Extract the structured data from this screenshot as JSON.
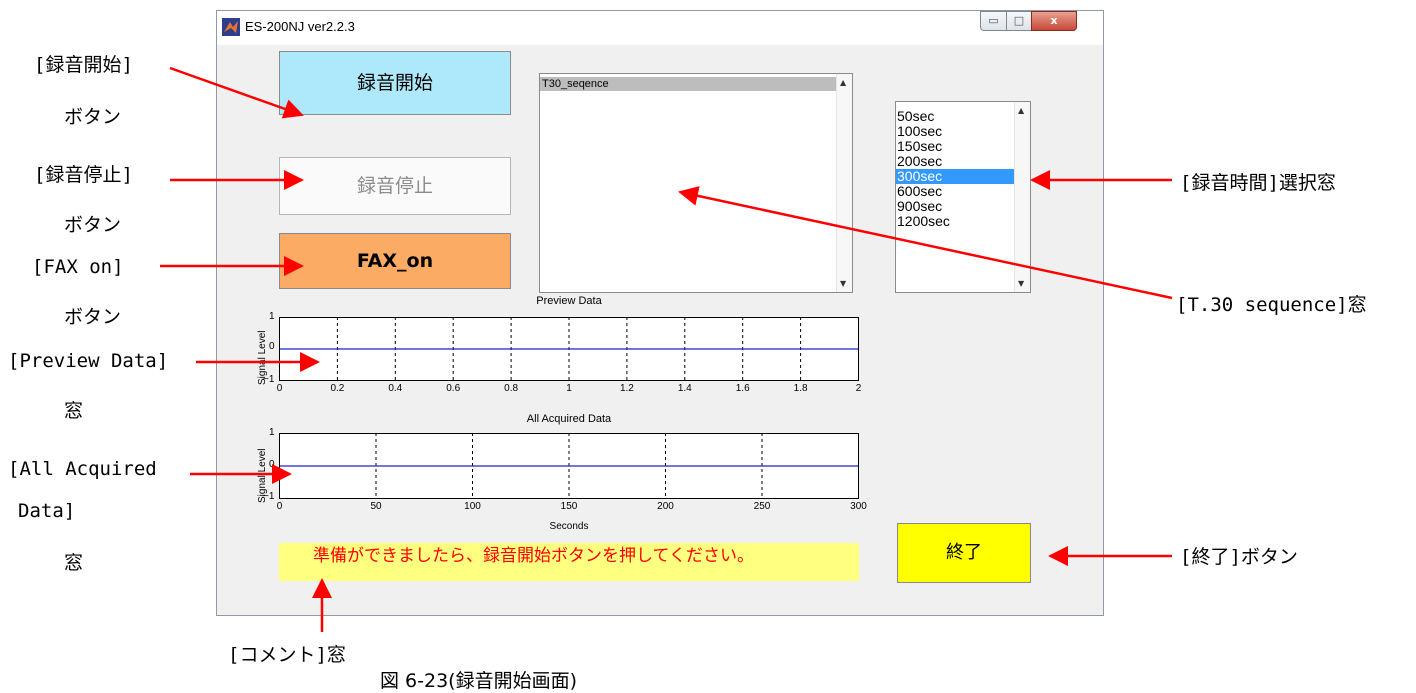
{
  "window": {
    "title": "ES-200NJ  ver2.2.3",
    "controls": {
      "minimize": "▭",
      "maximize": "□",
      "close": "x"
    }
  },
  "buttons": {
    "start": "録音開始",
    "stop": "録音停止",
    "fax_on": "FAX_on",
    "end": "終了"
  },
  "sequence_list": {
    "items": [
      "T30_seqence"
    ]
  },
  "time_list": {
    "items": [
      "50sec",
      "100sec",
      "150sec",
      "200sec",
      "300sec",
      "600sec",
      "900sec",
      "1200sec"
    ],
    "selected": "300sec"
  },
  "comment": "準備ができましたら、録音開始ボタンを押してください。",
  "plots": {
    "preview": {
      "title": "Preview Data",
      "ylabel": "Signal Level",
      "xticks": [
        "0",
        "0.2",
        "0.4",
        "0.6",
        "0.8",
        "1",
        "1.2",
        "1.4",
        "1.6",
        "1.8",
        "2"
      ],
      "yticks": [
        "1",
        "0",
        "−1"
      ],
      "xlim": [
        0,
        2
      ],
      "ylim": [
        -1,
        1
      ],
      "signal_value": 0
    },
    "all": {
      "title": "All Acquired Data",
      "ylabel": "Signal Level",
      "xlabel": "Seconds",
      "xticks": [
        "0",
        "50",
        "100",
        "150",
        "200",
        "250",
        "300"
      ],
      "yticks": [
        "1",
        "0",
        "−1"
      ],
      "xlim": [
        0,
        300
      ],
      "ylim": [
        -1,
        1
      ],
      "signal_value": 0
    }
  },
  "annotations": {
    "start_btn_1": "[録音開始]",
    "start_btn_2": "ボタン",
    "stop_btn_1": "[録音停止]",
    "stop_btn_2": "ボタン",
    "fax_btn_1": "[FAX on]",
    "fax_btn_2": "ボタン",
    "preview_1": "[Preview Data]",
    "preview_2": "窓",
    "all_1": "[All Acquired",
    "all_2": "Data]",
    "all_3": "窓",
    "time_select": "[録音時間]選択窓",
    "t30": "[T.30 sequence]窓",
    "end_btn": "[終了]ボタン",
    "comment": "[コメント]窓",
    "caption": "図 6-23(録音開始画面)"
  },
  "colors": {
    "annotation_arrow": "#ff0000",
    "start_button": "#aee9fb",
    "fax_button": "#fbab63",
    "end_button": "#ffff00",
    "comment_bg": "#ffff80",
    "comment_text": "#ff0000",
    "selection": "#3399ff",
    "signal_line": "#2222cc"
  }
}
